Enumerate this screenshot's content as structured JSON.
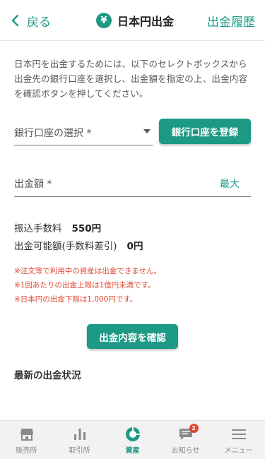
{
  "header": {
    "back_label": "戻る",
    "title": "日本円出金",
    "title_icon_glyph": "¥",
    "history_label": "出金履歴"
  },
  "description": {
    "line1": "日本円を出金するためには、以下のセレクトボックスから",
    "line2": "出金先の銀行口座を選択し、出金額を指定の上、出金内容",
    "line3": "を確認ボタンを押してください。"
  },
  "bank_select": {
    "label": "銀行口座の選択 *",
    "register_button": "銀行口座を登録"
  },
  "amount": {
    "label": "出金額 *",
    "max_label": "最大"
  },
  "fees": {
    "transfer_fee_label": "振込手数料",
    "transfer_fee_value": "550円",
    "available_label": "出金可能額(手数料差引)",
    "available_value": "0円"
  },
  "notes": [
    "※注文等で利用中の資産は出金できません。",
    "※1回あたりの出金上限は1億円未満です。",
    "※日本円の出金下限は1,000円です。"
  ],
  "confirm_button": "出金内容を確認",
  "recent_title": "最新の出金状況",
  "tabs": [
    {
      "label": "販売所",
      "icon": "store-icon"
    },
    {
      "label": "取引所",
      "icon": "bar-chart-icon"
    },
    {
      "label": "資産",
      "icon": "pie-chart-icon",
      "active": true
    },
    {
      "label": "お知らせ",
      "icon": "chat-bubble-icon",
      "badge": "2"
    },
    {
      "label": "メニュー",
      "icon": "hamburger-menu-icon"
    }
  ],
  "colors": {
    "accent": "#1c9a85",
    "warning": "#e0452f",
    "inactive_icon": "#8a8a8a"
  }
}
